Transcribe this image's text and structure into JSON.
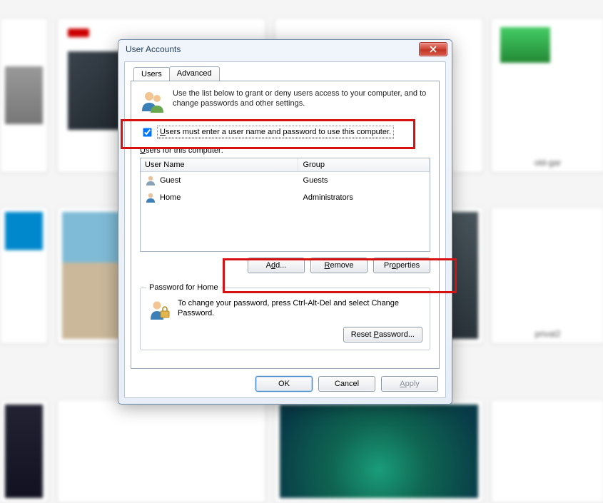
{
  "dialog": {
    "title": "User Accounts",
    "tabs": {
      "users": "Users",
      "advanced": "Advanced"
    },
    "intro": "Use the list below to grant or deny users access to your computer, and to change passwords and other settings.",
    "checkbox_label_pre": "U",
    "checkbox_label_rest": "sers must enter a user name and password to use this computer.",
    "checkbox_checked": true,
    "users_label": "Users for this computer:",
    "columns": {
      "name": "User Name",
      "group": "Group"
    },
    "rows": [
      {
        "name": "Guest",
        "group": "Guests",
        "icon": "guest"
      },
      {
        "name": "Home",
        "group": "Administrators",
        "icon": "user"
      }
    ],
    "buttons": {
      "add_pre": "A",
      "add_ul": "d",
      "add_post": "d...",
      "remove_ul": "R",
      "remove_post": "emove",
      "props_pre": "Pr",
      "props_ul": "o",
      "props_post": "perties"
    },
    "password_group": {
      "legend": "Password for Home",
      "text": "To change your password, press Ctrl-Alt-Del and select Change Password.",
      "reset_pre": "Reset ",
      "reset_ul": "P",
      "reset_post": "assword..."
    },
    "footer": {
      "ok": "OK",
      "cancel": "Cancel",
      "apply_ul": "A",
      "apply_post": "pply"
    }
  },
  "bg_labels": {
    "old": "old-gar",
    "privat": "privat2"
  }
}
